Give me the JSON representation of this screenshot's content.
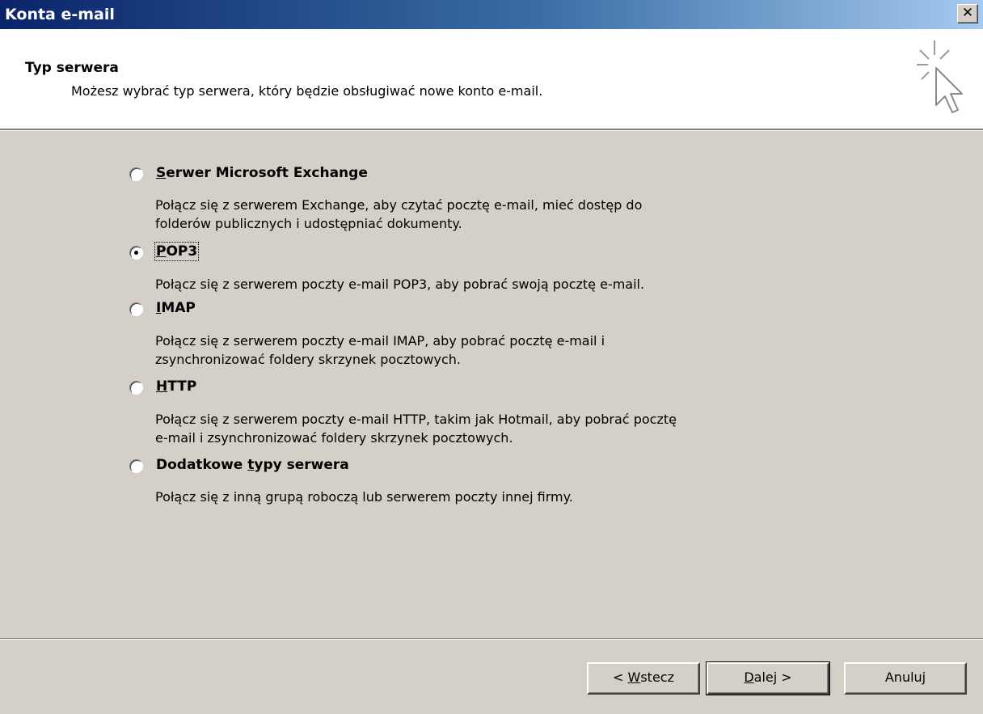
{
  "window": {
    "title": "Konta e-mail"
  },
  "header": {
    "title": "Typ serwera",
    "subtitle": "Możesz wybrać typ serwera, który będzie obsługiwać nowe konto e-mail."
  },
  "options": [
    {
      "access_key": "S",
      "label_rest": "erwer Microsoft Exchange",
      "selected": false,
      "desc_line1": "Połącz się z serwerem Exchange, aby czytać pocztę e-mail, mieć dostęp do",
      "desc_line2": "folderów publicznych i udostępniać dokumenty."
    },
    {
      "access_key": "P",
      "label_rest": "OP3",
      "selected": true,
      "desc_line1": "Połącz się z serwerem poczty e-mail POP3, aby pobrać swoją pocztę e-mail."
    },
    {
      "access_key": "I",
      "label_rest": "MAP",
      "selected": false,
      "desc_line1": "Połącz się z serwerem poczty e-mail IMAP, aby pobrać pocztę e-mail i",
      "desc_line2": "zsynchronizować foldery skrzynek pocztowych."
    },
    {
      "access_key": "H",
      "label_rest": "TTP",
      "selected": false,
      "desc_line1": "Połącz się z serwerem poczty e-mail HTTP, takim jak Hotmail, aby pobrać pocztę",
      "desc_line2": "e-mail i zsynchronizować foldery skrzynek pocztowych."
    },
    {
      "label_pre": "Dodatkowe ",
      "access_key": "t",
      "label_rest": "ypy serwera",
      "selected": false,
      "desc_line1": "Połącz się z inną grupą roboczą lub serwerem poczty innej firmy."
    }
  ],
  "buttons": {
    "back_pre": "< ",
    "back_key": "W",
    "back_rest": "stecz",
    "next_key": "D",
    "next_rest": "alej >",
    "cancel": "Anuluj"
  },
  "icons": {
    "close": "close-icon",
    "wizard": "cursor-sparkle-icon"
  }
}
